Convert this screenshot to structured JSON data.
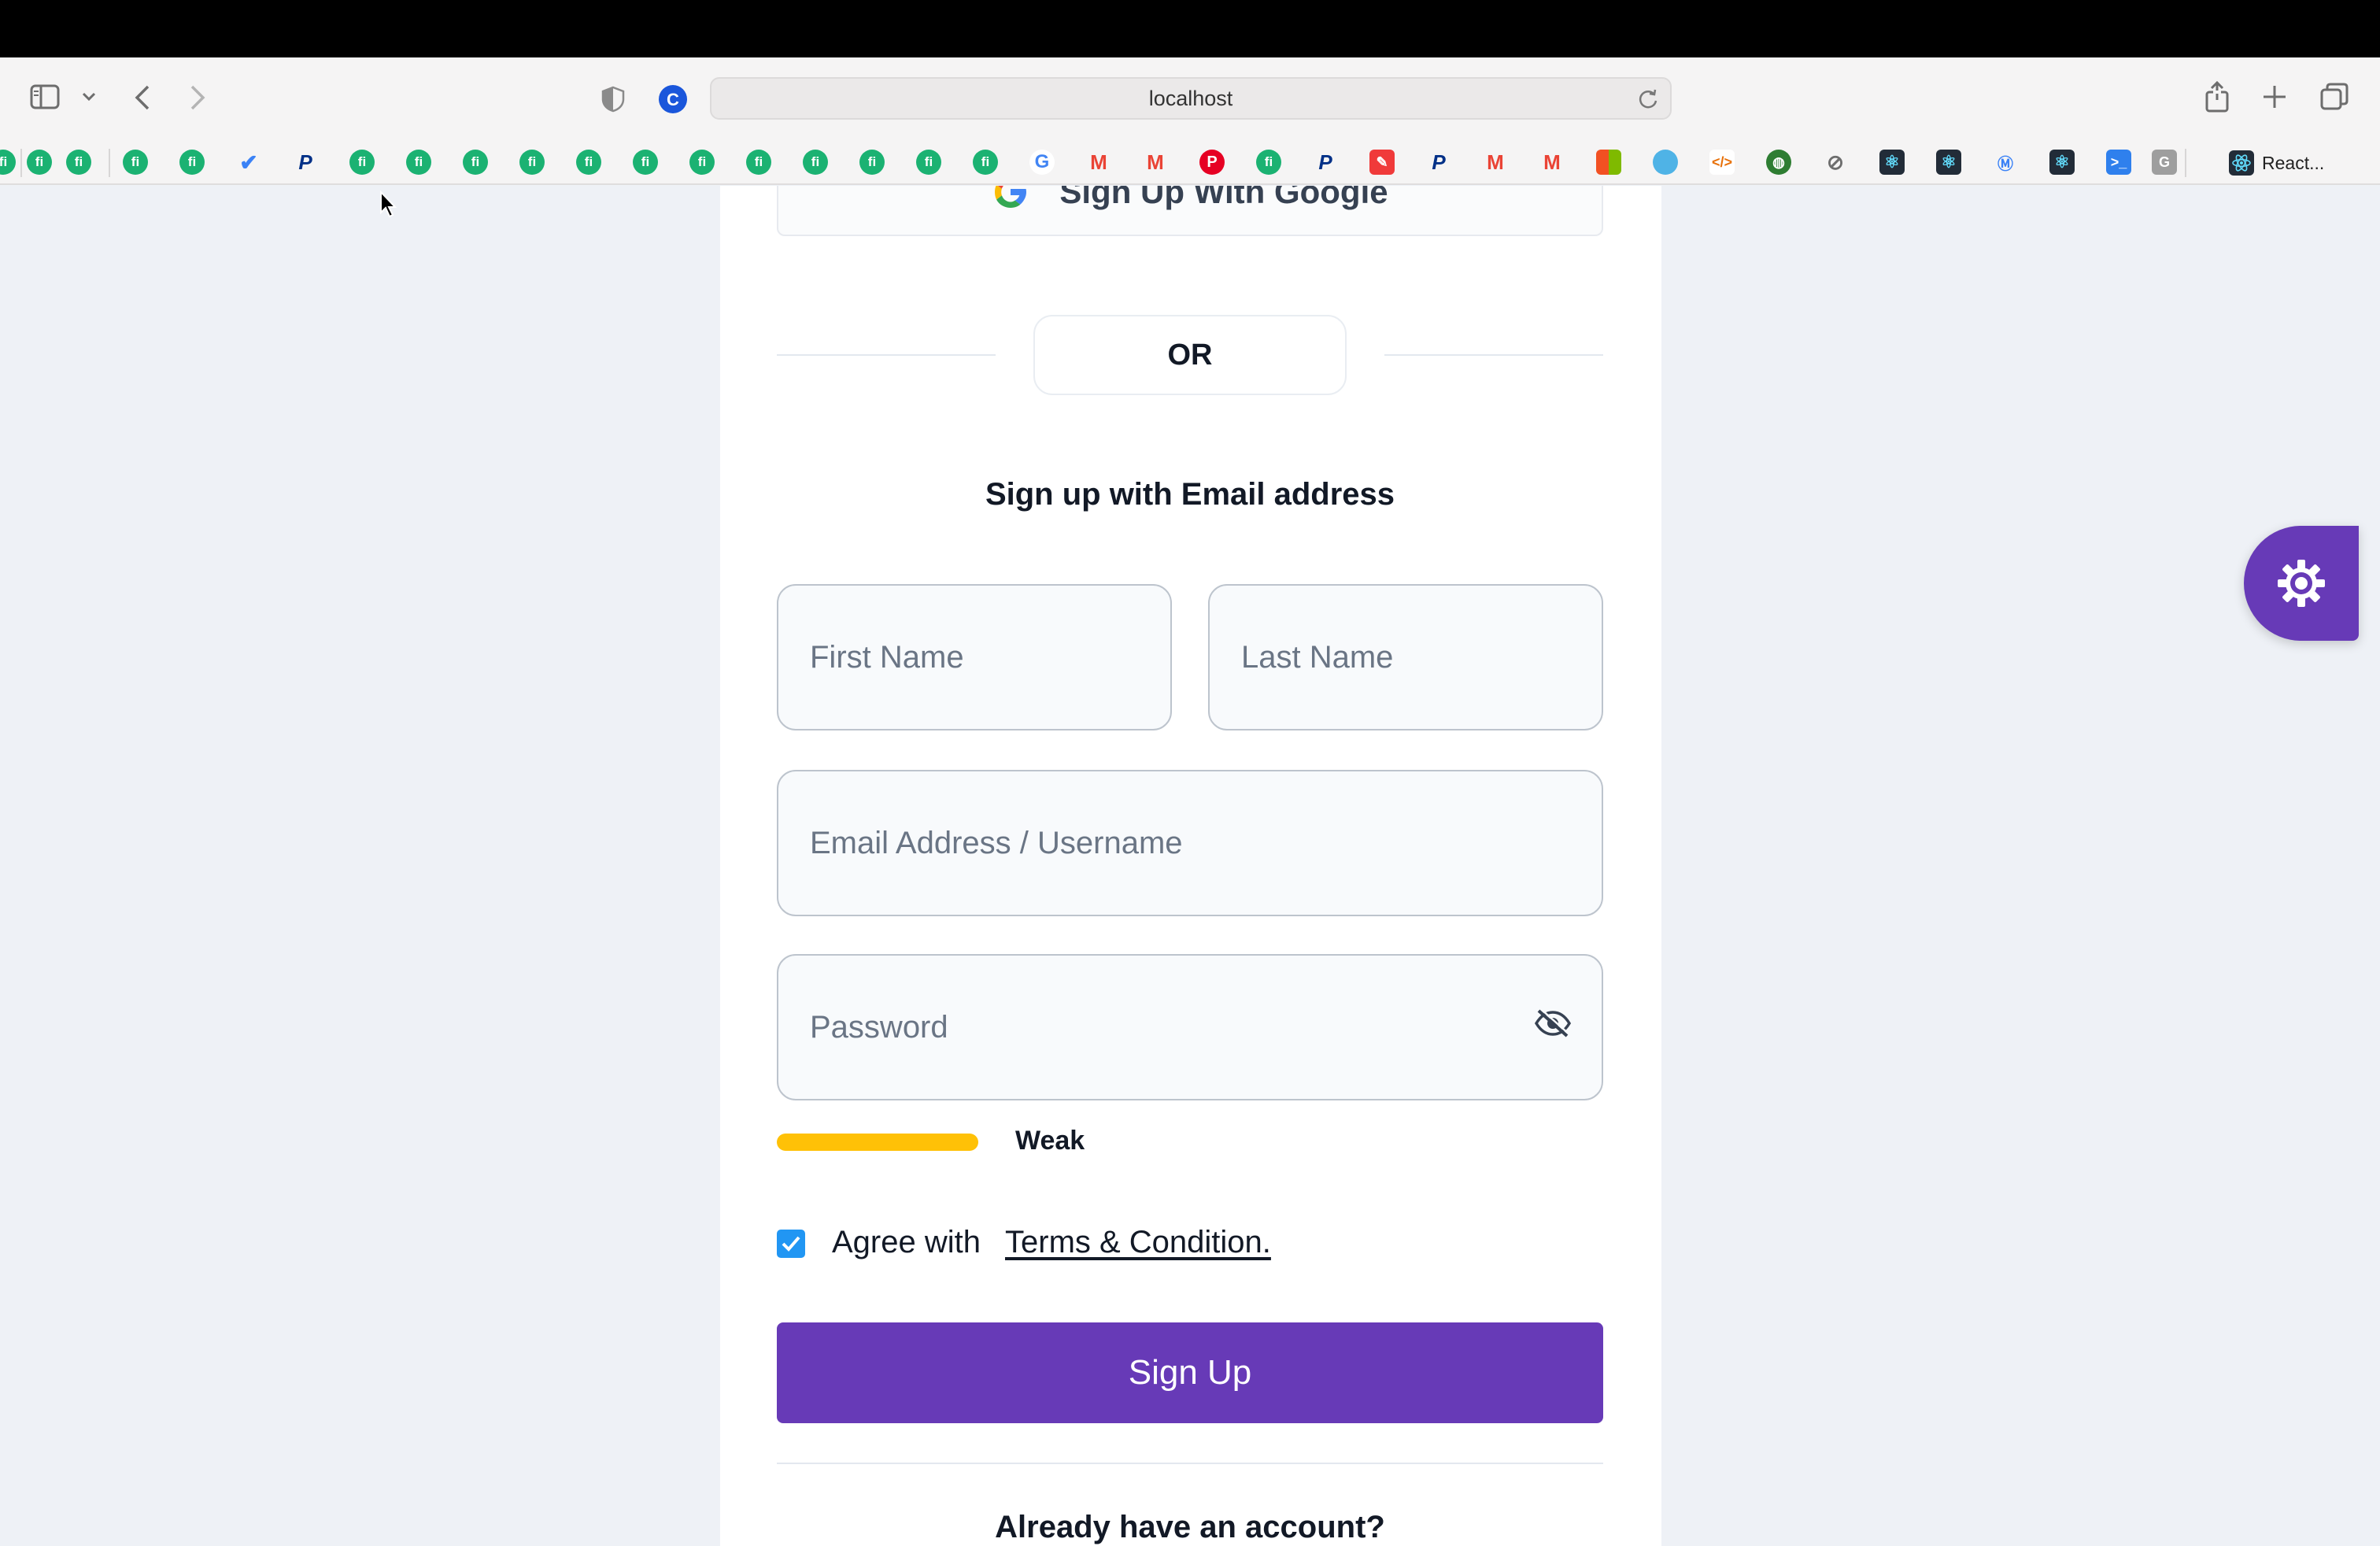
{
  "browser": {
    "url": "localhost",
    "bookmarks": {
      "react_label": "React..."
    }
  },
  "form": {
    "google_button_label": "Sign Up With Google",
    "or_label": "OR",
    "heading": "Sign up with Email address",
    "first_name_placeholder": "First Name",
    "last_name_placeholder": "Last Name",
    "email_placeholder": "Email Address / Username",
    "password_placeholder": "Password",
    "password_strength": {
      "label": "Weak",
      "color": "#ffc107"
    },
    "agree_text": "Agree with",
    "terms_link": "Terms & Condition.",
    "agree_checked": true,
    "signup_button_label": "Sign Up",
    "have_account_text": "Already have an account?"
  },
  "colors": {
    "primary": "#673ab7",
    "checkbox": "#2196f3",
    "page_background": "#eef1f6"
  }
}
